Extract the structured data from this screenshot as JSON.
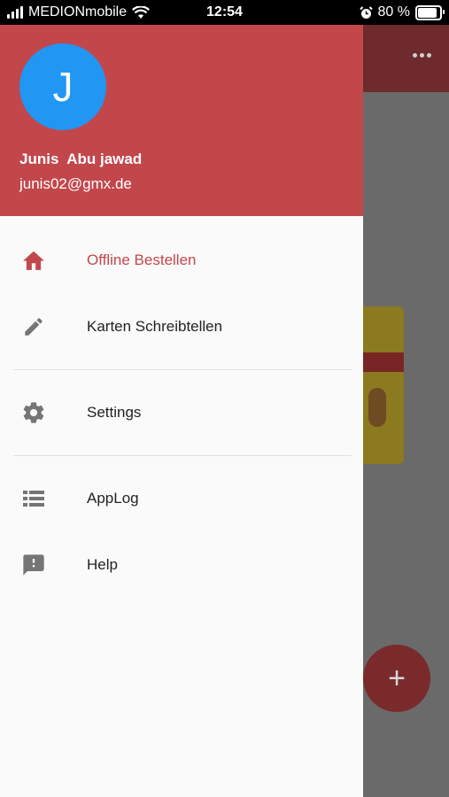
{
  "status_bar": {
    "carrier": "MEDIONmobile",
    "time": "12:54",
    "battery": "80 %"
  },
  "drawer": {
    "avatar_initial": "J",
    "user_name": "Junis  Abu jawad",
    "user_email": "junis02@gmx.de",
    "items": [
      {
        "label": "Offline Bestellen",
        "icon": "home-icon"
      },
      {
        "label": "Karten Schreibtellen",
        "icon": "pencil-icon"
      },
      {
        "label": "Settings",
        "icon": "gear-icon"
      },
      {
        "label": "AppLog",
        "icon": "list-icon"
      },
      {
        "label": "Help",
        "icon": "feedback-icon"
      }
    ]
  },
  "background_app": {
    "fab_label": "+"
  },
  "colors": {
    "header": "#c2474b",
    "accent": "#c2474b",
    "avatar": "#2196f3"
  }
}
